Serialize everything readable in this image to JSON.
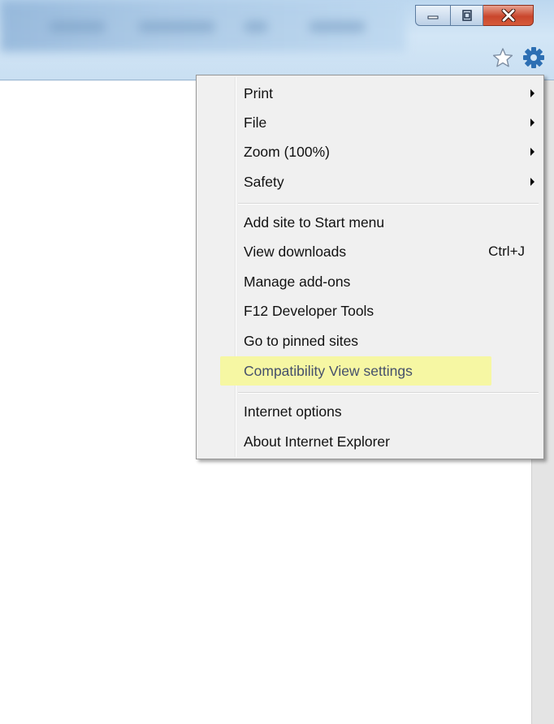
{
  "window": {
    "buttons": [
      {
        "name": "minimize",
        "icon": "minimize-icon"
      },
      {
        "name": "maximize",
        "icon": "maximize-icon"
      },
      {
        "name": "close",
        "icon": "close-icon"
      }
    ]
  },
  "toolbar": {
    "favorites_icon": "star-icon",
    "tools_icon": "gear-icon"
  },
  "menu": {
    "items": [
      {
        "label": "Print",
        "submenu": true
      },
      {
        "label": "File",
        "submenu": true
      },
      {
        "label": "Zoom (100%)",
        "submenu": true
      },
      {
        "label": "Safety",
        "submenu": true
      },
      {
        "label": "Add site to Start menu"
      },
      {
        "label": "View downloads",
        "shortcut": "Ctrl+J"
      },
      {
        "label": "Manage add-ons"
      },
      {
        "label": "F12 Developer Tools"
      },
      {
        "label": "Go to pinned sites"
      },
      {
        "label": "Compatibility View settings",
        "highlighted": true
      },
      {
        "label": "Internet options"
      },
      {
        "label": "About Internet Explorer"
      }
    ]
  },
  "colors": {
    "highlight": "#f6f7a3",
    "close_button": "#c9462c",
    "gear": "#2d6fb3"
  }
}
